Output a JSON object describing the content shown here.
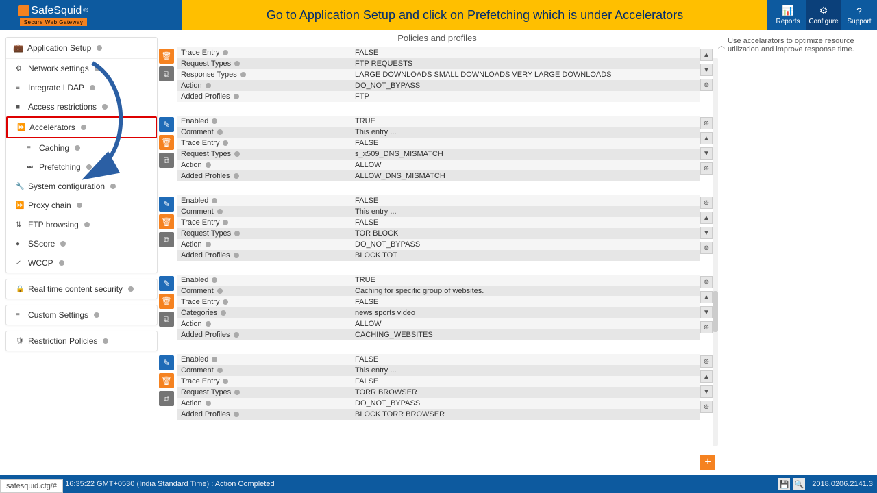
{
  "header": {
    "logo_text": "SafeSquid",
    "logo_reg": "®",
    "logo_sub": "Secure Web Gateway",
    "banner": "Go to Application Setup and click on Prefetching which is under Accelerators",
    "nav": [
      {
        "icon": "📊",
        "label": "Reports"
      },
      {
        "icon": "⚙",
        "label": "Configure"
      },
      {
        "icon": "?",
        "label": "Support"
      }
    ]
  },
  "sidebar": {
    "app_setup": "Application Setup",
    "items": [
      {
        "icon": "⚙",
        "label": "Network settings"
      },
      {
        "icon": "≡",
        "label": "Integrate LDAP"
      },
      {
        "icon": "■",
        "label": "Access restrictions"
      },
      {
        "icon": "⏩",
        "label": "Accelerators"
      },
      {
        "icon": "≡",
        "label": "Caching",
        "sub": true
      },
      {
        "icon": "⏭",
        "label": "Prefetching",
        "sub": true
      },
      {
        "icon": "🔧",
        "label": "System configuration"
      },
      {
        "icon": "⏩",
        "label": "Proxy chain"
      },
      {
        "icon": "⇅",
        "label": "FTP browsing"
      },
      {
        "icon": "●",
        "label": "SScore"
      },
      {
        "icon": "✓",
        "label": "WCCP"
      }
    ],
    "rtcs": "Real time content security",
    "custom": "Custom Settings",
    "restrict": "Restriction Policies"
  },
  "main": {
    "title": "Policies and profiles",
    "labels": {
      "enabled": "Enabled",
      "comment": "Comment",
      "trace": "Trace Entry",
      "reqtypes": "Request Types",
      "resptypes": "Response Types",
      "action": "Action",
      "added": "Added Profiles",
      "categories": "Categories"
    },
    "blocks": [
      {
        "rows": [
          [
            "trace",
            "FALSE"
          ],
          [
            "reqtypes",
            "FTP REQUESTS"
          ],
          [
            "resptypes",
            "LARGE DOWNLOADS  SMALL DOWNLOADS  VERY LARGE DOWNLOADS"
          ],
          [
            "action",
            "DO_NOT_BYPASS"
          ],
          [
            "added",
            "FTP"
          ]
        ],
        "icons": [
          "del",
          "copy"
        ],
        "ctrls": [
          "▲",
          "▼",
          "⊚"
        ]
      },
      {
        "rows": [
          [
            "enabled",
            "TRUE"
          ],
          [
            "comment",
            "This entry ..."
          ],
          [
            "trace",
            "FALSE"
          ],
          [
            "reqtypes",
            "s_x509_DNS_MISMATCH"
          ],
          [
            "action",
            "ALLOW"
          ],
          [
            "added",
            "ALLOW_DNS_MISMATCH"
          ]
        ],
        "icons": [
          "edit",
          "del",
          "copy"
        ],
        "ctrls": [
          "⊚",
          "▲",
          "▼",
          "⊚"
        ]
      },
      {
        "rows": [
          [
            "enabled",
            "FALSE"
          ],
          [
            "comment",
            "This entry ..."
          ],
          [
            "trace",
            "FALSE"
          ],
          [
            "reqtypes",
            "TOR BLOCK"
          ],
          [
            "action",
            "DO_NOT_BYPASS"
          ],
          [
            "added",
            "BLOCK TOT"
          ]
        ],
        "icons": [
          "edit",
          "del",
          "copy"
        ],
        "ctrls": [
          "⊚",
          "▲",
          "▼",
          "⊚"
        ]
      },
      {
        "rows": [
          [
            "enabled",
            "TRUE"
          ],
          [
            "comment",
            "Caching for specific group of websites."
          ],
          [
            "trace",
            "FALSE"
          ],
          [
            "categories",
            "news  sports  video"
          ],
          [
            "action",
            "ALLOW"
          ],
          [
            "added",
            "CACHING_WEBSITES"
          ]
        ],
        "icons": [
          "edit",
          "del",
          "copy"
        ],
        "ctrls": [
          "⊚",
          "▲",
          "▼",
          "⊚"
        ]
      },
      {
        "rows": [
          [
            "enabled",
            "FALSE"
          ],
          [
            "comment",
            "This entry ..."
          ],
          [
            "trace",
            "FALSE"
          ],
          [
            "reqtypes",
            "TORR BROWSER"
          ],
          [
            "action",
            "DO_NOT_BYPASS"
          ],
          [
            "added",
            "BLOCK TORR BROWSER"
          ]
        ],
        "icons": [
          "edit",
          "del",
          "copy"
        ],
        "ctrls": [
          "⊚",
          "▲",
          "▼",
          "⊚"
        ]
      }
    ]
  },
  "right": {
    "note": "Use accelarators to optimize resource utilization and improve response time."
  },
  "footer": {
    "cfg": "safesquid.cfg/#",
    "status": "8 16:35:22 GMT+0530 (India Standard Time) : Action Completed",
    "version": "2018.0206.2141.3"
  }
}
